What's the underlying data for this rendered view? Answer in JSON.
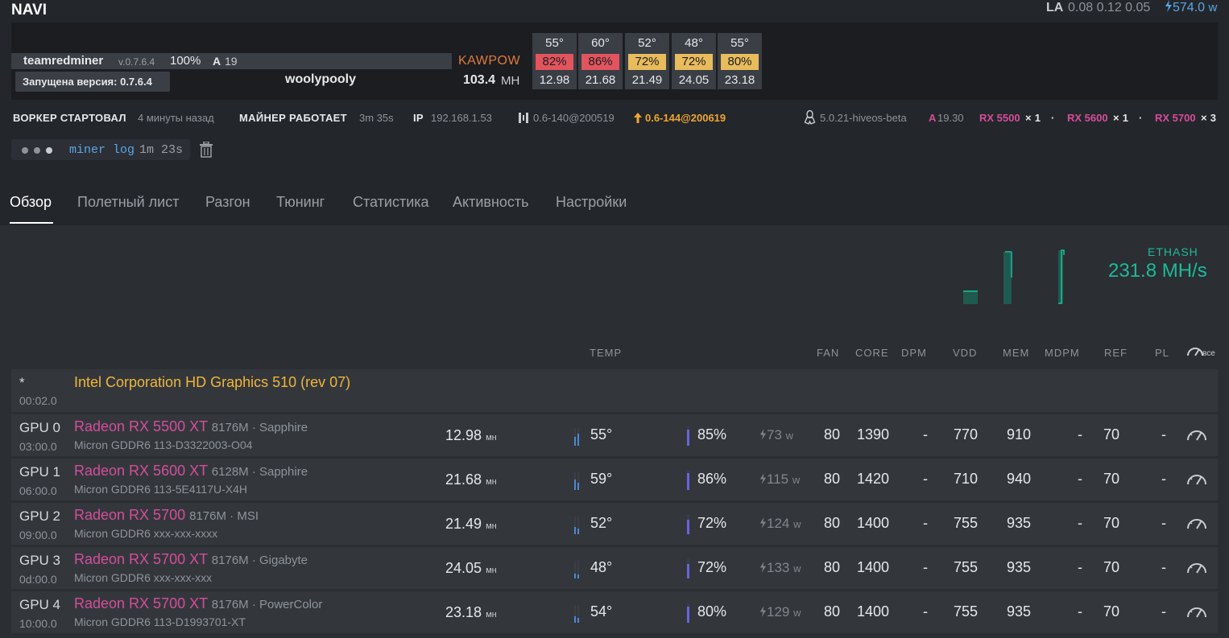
{
  "header": {
    "worker_name": "NAVI",
    "la_label": "LA",
    "la_values": "0.08 0.12 0.05",
    "power_total": "574.0",
    "power_unit": "w",
    "power_icon": "lightning-icon"
  },
  "miner": {
    "name": "teamredminer",
    "version": "v.0.7.6.4",
    "percent": "100%",
    "accepted_letter": "A",
    "accepted_value": "19",
    "tooltip": "Запущена версия: 0.7.6.4",
    "pool": "woolypooly",
    "algo": "KAWPOW",
    "total_hashrate": "103.4",
    "total_hashrate_unit": "MH"
  },
  "tiles": [
    {
      "temp": "55°",
      "fan": "82%",
      "fan_color": "#e2545e",
      "hash": "12.98"
    },
    {
      "temp": "60°",
      "fan": "86%",
      "fan_color": "#e2545e",
      "hash": "21.68"
    },
    {
      "temp": "52°",
      "fan": "72%",
      "fan_color": "#e8bb5c",
      "hash": "21.49"
    },
    {
      "temp": "48°",
      "fan": "72%",
      "fan_color": "#e8bb5c",
      "hash": "24.05"
    },
    {
      "temp": "55°",
      "fan": "80%",
      "fan_color": "#e8bb5c",
      "hash": "23.18"
    }
  ],
  "info": {
    "worker_started_label": "ВОРКЕР СТАРТОВАЛ",
    "worker_started_value": "4 минуты назад",
    "miner_running_label": "МАЙНЕР РАБОТАЕТ",
    "miner_running_value": "3m 35s",
    "ip_label": "IP",
    "ip_value": "192.168.1.53",
    "hive_version": "0.6-140@200519",
    "hive_update": "0.6-144@200619",
    "kernel": "5.0.21-hiveos-beta",
    "amd_letter": "A",
    "amd_version": "19.30",
    "gpu_counts": [
      {
        "model": "RX 5500",
        "count": "× 1"
      },
      {
        "model": "RX 5600",
        "count": "× 1"
      },
      {
        "model": "RX 5700",
        "count": "× 3"
      }
    ],
    "separator": "·"
  },
  "log": {
    "label": "miner log",
    "time": "1m 23s"
  },
  "tabs": [
    "Обзор",
    "Полетный лист",
    "Разгон",
    "Тюнинг",
    "Статистика",
    "Активность",
    "Настройки"
  ],
  "active_tab": "Обзор",
  "algo_summary": {
    "algo": "ETHASH",
    "hashrate": "231.8 MH/s"
  },
  "columns": {
    "temp": "TEMP",
    "fan": "FAN",
    "core": "CORE",
    "dpm": "DPM",
    "vdd": "VDD",
    "mem": "MEM",
    "mdpm": "MDPM",
    "ref": "REF",
    "pl": "PL",
    "all": "все"
  },
  "intel": {
    "id": "*",
    "bus": "00:02.0",
    "name": "Intel Corporation HD Graphics 510 (rev 07)"
  },
  "gpus": [
    {
      "id": "GPU 0",
      "bus": "03:00.0",
      "model": "Radeon RX 5500 XT",
      "sub": "8176M · Sapphire",
      "mem": "Micron GDDR6 113-D3322003-O04",
      "hash": "12.98",
      "hash_unit": "мн",
      "temp": "55°",
      "fan": "85%",
      "power": "73",
      "power_unit": "w",
      "fan_setting": "80",
      "core": "1390",
      "dpm": "-",
      "vdd": "770",
      "memclk": "910",
      "mdpm": "-",
      "ref": "70",
      "pl": "-"
    },
    {
      "id": "GPU 1",
      "bus": "06:00.0",
      "model": "Radeon RX 5600 XT",
      "sub": "6128M · Sapphire",
      "mem": "Micron GDDR6 113-5E4117U-X4H",
      "hash": "21.68",
      "hash_unit": "мн",
      "temp": "59°",
      "fan": "86%",
      "power": "115",
      "power_unit": "w",
      "fan_setting": "80",
      "core": "1420",
      "dpm": "-",
      "vdd": "710",
      "memclk": "940",
      "mdpm": "-",
      "ref": "70",
      "pl": "-"
    },
    {
      "id": "GPU 2",
      "bus": "09:00.0",
      "model": "Radeon RX 5700",
      "sub": "8176M · MSI",
      "mem": "Micron GDDR6 xxx-xxx-xxxx",
      "hash": "21.49",
      "hash_unit": "мн",
      "temp": "52°",
      "fan": "72%",
      "power": "124",
      "power_unit": "w",
      "fan_setting": "80",
      "core": "1400",
      "dpm": "-",
      "vdd": "755",
      "memclk": "935",
      "mdpm": "-",
      "ref": "70",
      "pl": "-"
    },
    {
      "id": "GPU 3",
      "bus": "0d:00.0",
      "model": "Radeon RX 5700 XT",
      "sub": "8176M · Gigabyte",
      "mem": "Micron GDDR6 xxx-xxx-xxx",
      "hash": "24.05",
      "hash_unit": "мн",
      "temp": "48°",
      "fan": "72%",
      "power": "133",
      "power_unit": "w",
      "fan_setting": "80",
      "core": "1400",
      "dpm": "-",
      "vdd": "755",
      "memclk": "935",
      "mdpm": "-",
      "ref": "70",
      "pl": "-"
    },
    {
      "id": "GPU 4",
      "bus": "10:00.0",
      "model": "Radeon RX 5700 XT",
      "sub": "8176M · PowerColor",
      "mem": "Micron GDDR6 113-D1993701-XT",
      "hash": "23.18",
      "hash_unit": "мн",
      "temp": "54°",
      "fan": "80%",
      "power": "129",
      "power_unit": "w",
      "fan_setting": "80",
      "core": "1400",
      "dpm": "-",
      "vdd": "755",
      "memclk": "935",
      "mdpm": "-",
      "ref": "70",
      "pl": "-"
    }
  ]
}
